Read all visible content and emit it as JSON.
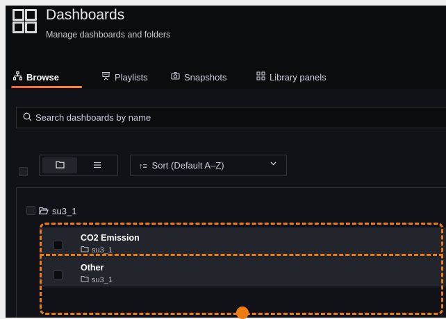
{
  "header": {
    "title": "Dashboards",
    "subtitle": "Manage dashboards and folders",
    "icon": "dashboard-grid-icon"
  },
  "tabs": [
    {
      "label": "Browse",
      "icon": "sitemap-icon",
      "active": true
    },
    {
      "label": "Playlists",
      "icon": "presentation-icon",
      "active": false
    },
    {
      "label": "Snapshots",
      "icon": "camera-icon",
      "active": false
    },
    {
      "label": "Library panels",
      "icon": "apps-icon",
      "active": false
    }
  ],
  "search": {
    "placeholder": "Search dashboards by name"
  },
  "toolbar": {
    "sort_label": "Sort (Default A–Z)"
  },
  "folder": {
    "name": "su3_1"
  },
  "dashboards": [
    {
      "title": "CO2 Emission",
      "folder": "su3_1"
    },
    {
      "title": "Other",
      "folder": "su3_1"
    }
  ],
  "colors": {
    "accent": "#ef7b13",
    "background": "#111217",
    "row": "#22252b"
  }
}
